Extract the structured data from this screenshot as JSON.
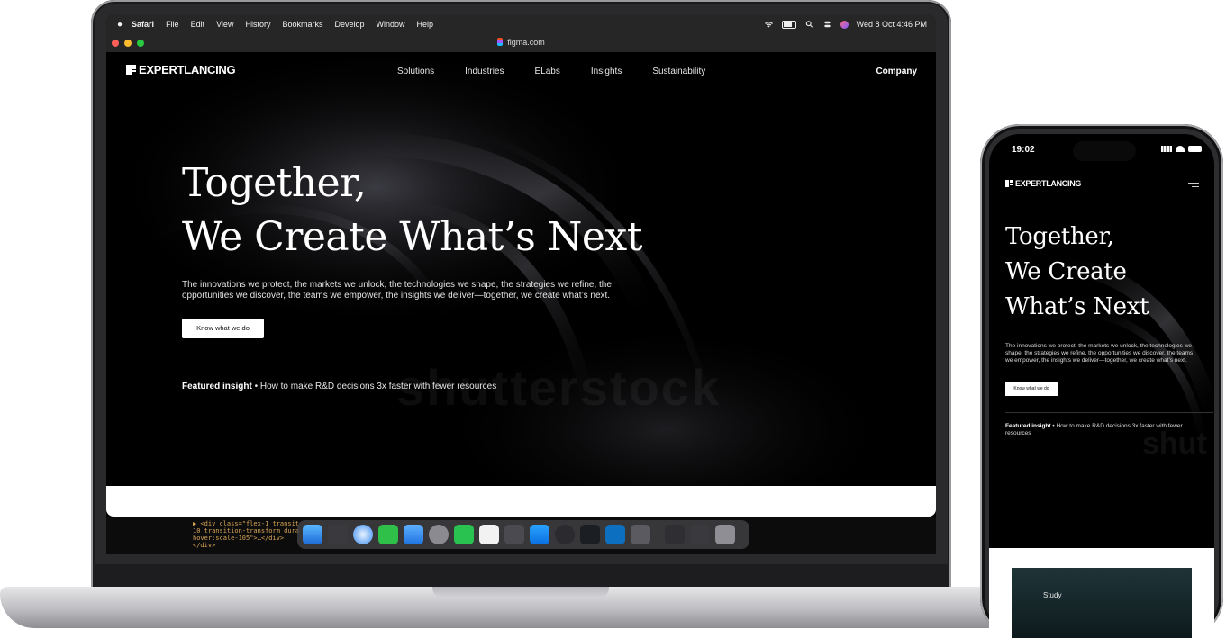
{
  "mac": {
    "menubar": {
      "items": [
        "Safari",
        "File",
        "Edit",
        "View",
        "History",
        "Bookmarks",
        "Develop",
        "Window",
        "Help"
      ],
      "datetime": "Wed 8 Oct  4:46 PM"
    },
    "browser": {
      "url": "figma.com"
    },
    "dock": {
      "code_snippet": "▶ <div class=\"flex-1 transit\n10 transition-transform dura\nhover:scale-105\">…</div>\n</div>"
    }
  },
  "site": {
    "logo": "EXPERTLANCING",
    "nav": [
      "Solutions",
      "Industries",
      "ELabs",
      "Insights",
      "Sustainability"
    ],
    "nav_company": "Company",
    "hero_line1": "Together,",
    "hero_line2": "We Create What’s Next",
    "description": "The innovations we protect, the markets we unlock, the technologies we shape, the strategies we refine, the opportunities we discover, the teams we empower, the insights we deliver—together, we create what’s next.",
    "cta": "Know what we do",
    "featured_label": "Featured insight",
    "featured_sep": "•",
    "featured_text": "How to make R&D decisions 3x faster with fewer resources",
    "watermark": "shutterstock"
  },
  "phone": {
    "time": "19:02",
    "title_lines": [
      "Together,",
      "We Create",
      "What’s Next"
    ],
    "card_label": "Study",
    "watermark": "shut"
  },
  "colors": {
    "accent": "#ffffff",
    "background": "#000000",
    "device_frame": "#2a2a2c"
  }
}
